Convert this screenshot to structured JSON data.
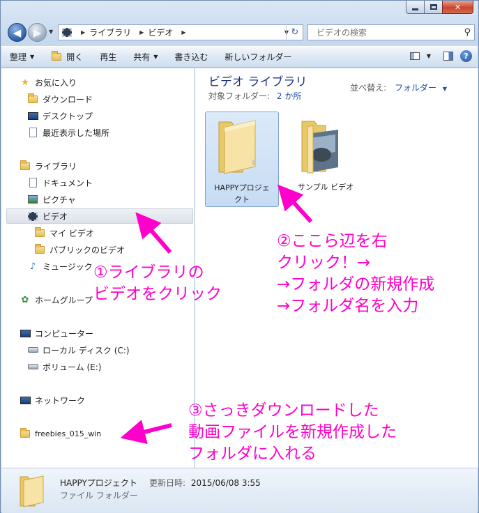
{
  "address": {
    "segments": [
      "ライブラリ",
      "ビデオ"
    ]
  },
  "search": {
    "placeholder": "ビデオの検索"
  },
  "toolbar": {
    "organize": "整理",
    "open": "開く",
    "play": "再生",
    "share": "共有",
    "burn": "書き込む",
    "new_folder": "新しいフォルダー"
  },
  "sidebar": {
    "favorites": "お気に入り",
    "downloads": "ダウンロード",
    "desktop": "デスクトップ",
    "recent": "最近表示した場所",
    "libraries": "ライブラリ",
    "documents": "ドキュメント",
    "pictures": "ピクチャ",
    "videos": "ビデオ",
    "my_videos": "マイ ビデオ",
    "public_videos": "パブリックのビデオ",
    "music": "ミュージック",
    "homegroup": "ホームグループ",
    "computer": "コンピューター",
    "local_disk": "ローカル ディスク (C:)",
    "volume_e": "ボリューム (E:)",
    "network": "ネットワーク",
    "freebies": "freebies_015_win"
  },
  "content": {
    "title": "ビデオ ライブラリ",
    "target_label": "対象フォルダー:",
    "target_count": "2 か所",
    "sort_label": "並べ替え:",
    "sort_value": "フォルダー",
    "items": [
      {
        "line1": "HAPPYプロジェ",
        "line2": "クト"
      },
      {
        "line1": "サンプル ビデオ",
        "line2": ""
      }
    ]
  },
  "details": {
    "name": "HAPPYプロジェクト",
    "modified_label": "更新日時:",
    "modified_value": "2015/06/08 3:55",
    "type": "ファイル フォルダー"
  },
  "annotations": {
    "note1": [
      "①ライブラリの",
      "ビデオをクリック"
    ],
    "note2": [
      "②ここら辺を右",
      "クリック！→",
      "→フォルダの新規作成",
      "→フォルダ名を入力"
    ],
    "note3": [
      "③さっきダウンロードした",
      "動画ファイルを新規作成した",
      "フォルダに入れる"
    ]
  },
  "colors": {
    "annotation": "#ff00cc",
    "title_blue": "#1e3287",
    "link_blue": "#1f4fa8"
  }
}
